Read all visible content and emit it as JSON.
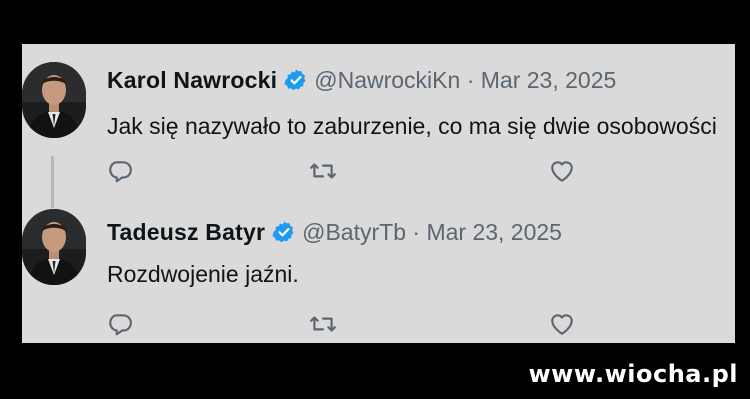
{
  "tweets": [
    {
      "name": "Karol Nawrocki",
      "handle": "@NawrockiKn",
      "separator": "·",
      "date": "Mar 23, 2025",
      "text": "Jak się nazywało to zaburzenie, co ma się dwie osobowości"
    },
    {
      "name": "Tadeusz Batyr",
      "handle": "@BatyrTb",
      "separator": "·",
      "date": "Mar 23, 2025",
      "text": "Rozdwojenie jaźni."
    }
  ],
  "icons": [
    "avatar",
    "verified-badge-icon",
    "reply-icon",
    "retweet-icon",
    "like-icon"
  ],
  "colors": {
    "panel": "#dadada",
    "verified": "#1d9bf0",
    "muted": "#5b6671",
    "background": "#000000"
  },
  "watermark": "www.wiocha.pl"
}
